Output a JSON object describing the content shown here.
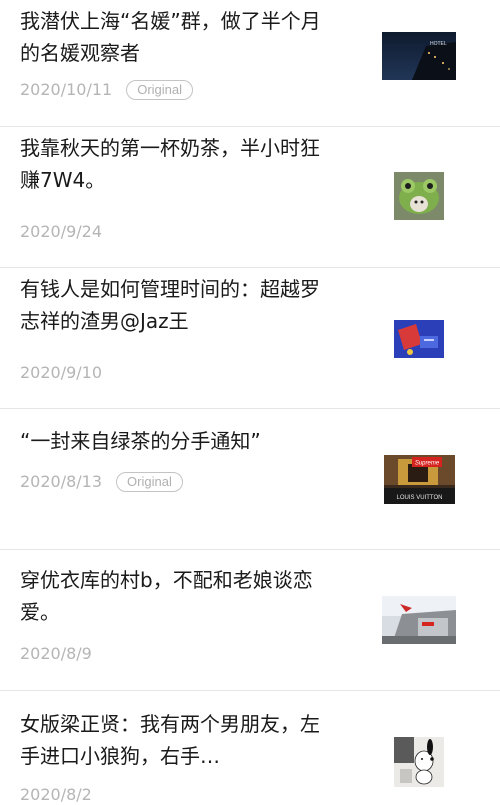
{
  "articles": [
    {
      "title": "我潜伏上海“名媛”群，做了半个月的名媛观察者",
      "date": "2020/10/11",
      "badge": "Original",
      "thumb_icon": "hotel-night-photo-icon"
    },
    {
      "title": "我靠秋天的第一杯奶茶，半小时狂赚7W4。",
      "date": "2020/9/24",
      "badge": "",
      "thumb_icon": "frog-hat-photo-icon"
    },
    {
      "title": "有钱人是如何管理时间的：超越罗志祥的渣男@Jaz王",
      "date": "2020/9/10",
      "badge": "",
      "thumb_icon": "blue-wallet-photo-icon"
    },
    {
      "title": "“一封来自绿茶的分手通知”",
      "date": "2020/8/13",
      "badge": "Original",
      "thumb_icon": "supreme-lv-photo-icon",
      "thumb_text": [
        "Supreme",
        "LOUIS VUITTON"
      ]
    },
    {
      "title": "穿优衣库的村b，不配和老娘谈恋爱。",
      "date": "2020/8/9",
      "badge": "",
      "thumb_icon": "supreme-store-photo-icon"
    },
    {
      "title": "女版梁正贤：我有两个男朋友，左手进口小狼狗，右手…",
      "date": "2020/8/2",
      "badge": "",
      "thumb_icon": "snoopy-photo-icon"
    }
  ]
}
